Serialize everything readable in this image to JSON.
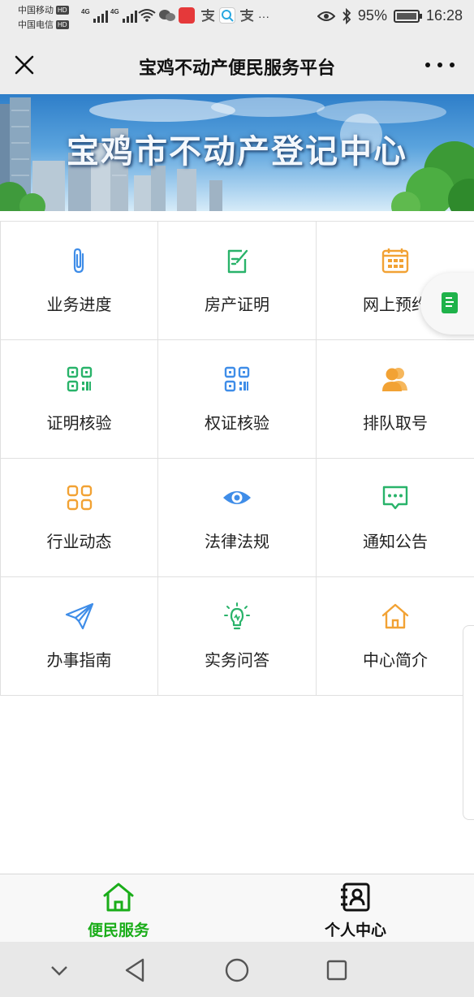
{
  "status_bar": {
    "carrier1": "中国移动",
    "carrier2": "中国电信",
    "hd1": "HD",
    "hd2": "HD",
    "net1": "4G",
    "net2": "4G",
    "battery": "95%",
    "time": "16:28",
    "overflow": "···"
  },
  "header": {
    "title": "宝鸡不动产便民服务平台"
  },
  "banner": {
    "title": "宝鸡市不动产登记中心"
  },
  "grid": {
    "items": [
      {
        "label": "业务进度",
        "icon": "paperclip-icon",
        "color": "#3f8de8"
      },
      {
        "label": "房产证明",
        "icon": "edit-document-icon",
        "color": "#29b36a"
      },
      {
        "label": "网上预约",
        "icon": "calendar-icon",
        "color": "#f2a234"
      },
      {
        "label": "证明核验",
        "icon": "qr-code-icon",
        "color": "#29b36a"
      },
      {
        "label": "权证核验",
        "icon": "qr-code-icon",
        "color": "#3f8de8"
      },
      {
        "label": "排队取号",
        "icon": "users-icon",
        "color": "#f2a234"
      },
      {
        "label": "行业动态",
        "icon": "grid-icon",
        "color": "#f2a234"
      },
      {
        "label": "法律法规",
        "icon": "eye-icon",
        "color": "#3f8de8"
      },
      {
        "label": "通知公告",
        "icon": "message-icon",
        "color": "#29b36a"
      },
      {
        "label": "办事指南",
        "icon": "paper-plane-icon",
        "color": "#3f8de8"
      },
      {
        "label": "实务问答",
        "icon": "lightbulb-icon",
        "color": "#29b36a"
      },
      {
        "label": "中心简介",
        "icon": "home-icon",
        "color": "#f2a234"
      }
    ]
  },
  "tabs": [
    {
      "label": "便民服务",
      "icon": "home-icon",
      "active": true,
      "color": "#1aad19"
    },
    {
      "label": "个人中心",
      "icon": "contact-book-icon",
      "active": false,
      "color": "#111111"
    }
  ],
  "colors": {
    "accent": "#1aad19",
    "blue": "#3f8de8",
    "green": "#29b36a",
    "orange": "#f2a234"
  }
}
